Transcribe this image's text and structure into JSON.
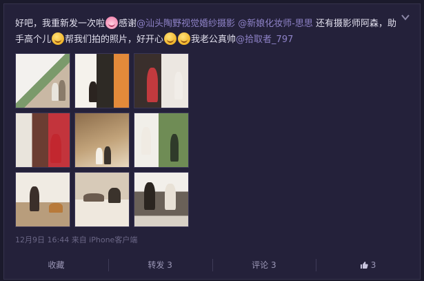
{
  "post": {
    "segments": [
      {
        "type": "text",
        "text": "好吧，我重新发一次啦"
      },
      {
        "type": "emoji",
        "name": "bunny-emoji"
      },
      {
        "type": "text",
        "text": "感谢"
      },
      {
        "type": "mention",
        "text": "@汕头陶野视觉婚纱摄影"
      },
      {
        "type": "text",
        "text": " "
      },
      {
        "type": "mention",
        "text": "@新娘化妆师-思思"
      },
      {
        "type": "text",
        "text": " 还有摄影师阿森，助手高个儿"
      },
      {
        "type": "emoji",
        "name": "smile-emoji"
      },
      {
        "type": "text",
        "text": "帮我们拍的照片，好开心"
      },
      {
        "type": "emoji",
        "name": "happy-emoji"
      },
      {
        "type": "emoji",
        "name": "happy-emoji"
      },
      {
        "type": "text",
        "text": "我老公真帅"
      },
      {
        "type": "mention",
        "text": "@拾取者_797"
      }
    ],
    "meta": "12月9日 16:44 来自 iPhone客户端",
    "photo_count": 9
  },
  "actions": {
    "favorite": "收藏",
    "repost": "转发 3",
    "comment": "评论 3",
    "like": "3"
  },
  "colors": {
    "background": "#1b1a2c",
    "card": "#24213a",
    "mention": "#8e82c7"
  }
}
